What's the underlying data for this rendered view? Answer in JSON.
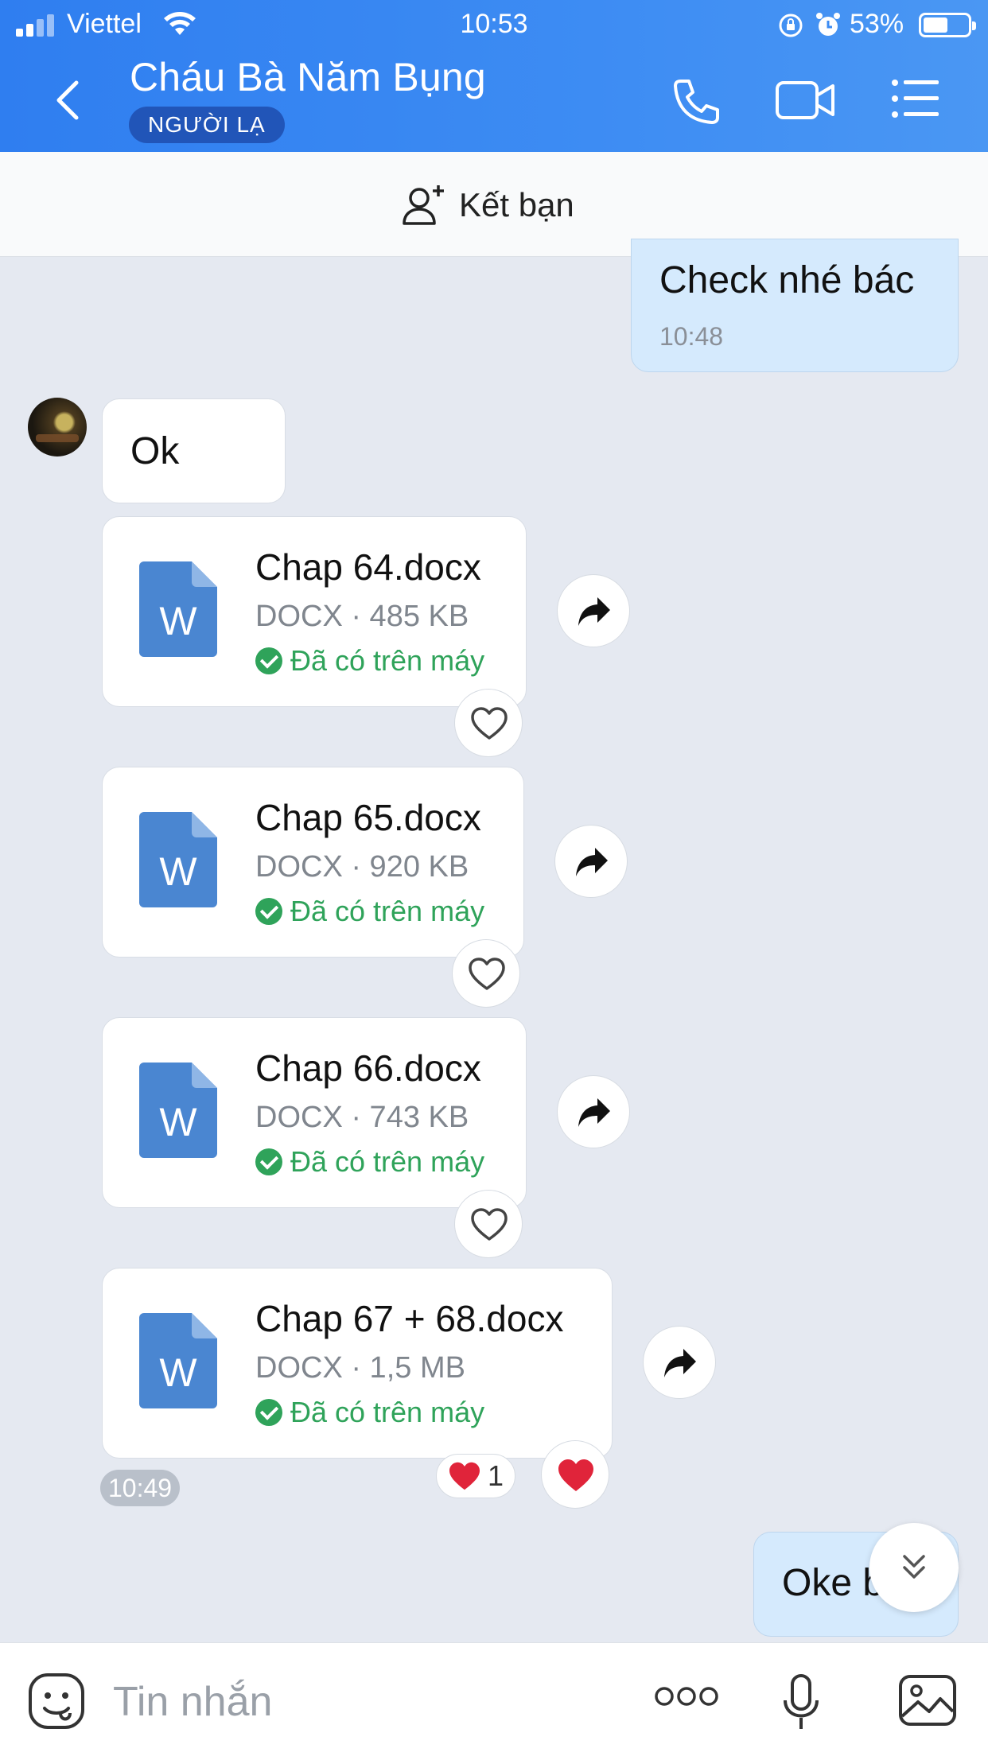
{
  "status_bar": {
    "carrier": "Viettel",
    "time": "10:53",
    "battery": "53%"
  },
  "header": {
    "title": "Cháu Bà Năm Bụng",
    "badge": "NGƯỜI LẠ"
  },
  "add_friend": {
    "label": "Kết bạn"
  },
  "messages": {
    "sent_1": {
      "text": "Check nhé bác",
      "time": "10:48"
    },
    "recv_1": {
      "text": "Ok"
    },
    "files": [
      {
        "name": "Chap 64.docx",
        "meta": "DOCX · 485 KB",
        "status": "Đã có trên máy",
        "icon_letter": "W"
      },
      {
        "name": "Chap 65.docx",
        "meta": "DOCX · 920 KB",
        "status": "Đã có trên máy",
        "icon_letter": "W"
      },
      {
        "name": "Chap 66.docx",
        "meta": "DOCX · 743 KB",
        "status": "Đã có trên máy",
        "icon_letter": "W"
      },
      {
        "name": "Chap 67 + 68.docx",
        "meta": "DOCX · 1,5 MB",
        "status": "Đã có trên máy",
        "icon_letter": "W"
      }
    ],
    "recv_time": "10:49",
    "reaction_count": "1",
    "sent_2": {
      "text": "Oke b"
    }
  },
  "input": {
    "placeholder": "Tin nhắn"
  },
  "colors": {
    "header": "#3d8cf3",
    "badge": "#2155b8",
    "sent_bubble": "#d5eafd",
    "status_green": "#2fa35a",
    "heart": "#e0243a",
    "doc_blue": "#4a86d1"
  }
}
